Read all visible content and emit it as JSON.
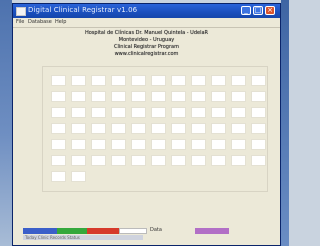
{
  "window": {
    "title": "Digital Clinical Registrar v1.06"
  },
  "menu": {
    "items": [
      "File",
      "Database",
      "Help"
    ]
  },
  "header": {
    "line1": "Hospital de Clínicas Dr. Manuel Quintela - UdelaR",
    "line2": "Montevideo - Uruguay",
    "line3": "Clinical Registrar Program",
    "line4": "www.clinicalregistrar.com"
  },
  "grid": {
    "rows": 7,
    "cols": 11,
    "last_row_cells": 2
  },
  "status": {
    "segments": [
      {
        "name": "blue",
        "color": "#3b5fc9"
      },
      {
        "name": "green",
        "color": "#35a83c"
      },
      {
        "name": "red",
        "color": "#d63a2b"
      },
      {
        "name": "white",
        "color": "#ffffff"
      },
      {
        "name": "empty",
        "color": "#ece9d8"
      },
      {
        "name": "purple",
        "color": "#b26fc6"
      }
    ],
    "label_mid": "Data",
    "under_text": "Today  Clinic  Records  Status"
  },
  "colors": {
    "titlebar": "#1a4fbd",
    "window_bg": "#ece9d8",
    "desktop": "#c9d3df"
  }
}
